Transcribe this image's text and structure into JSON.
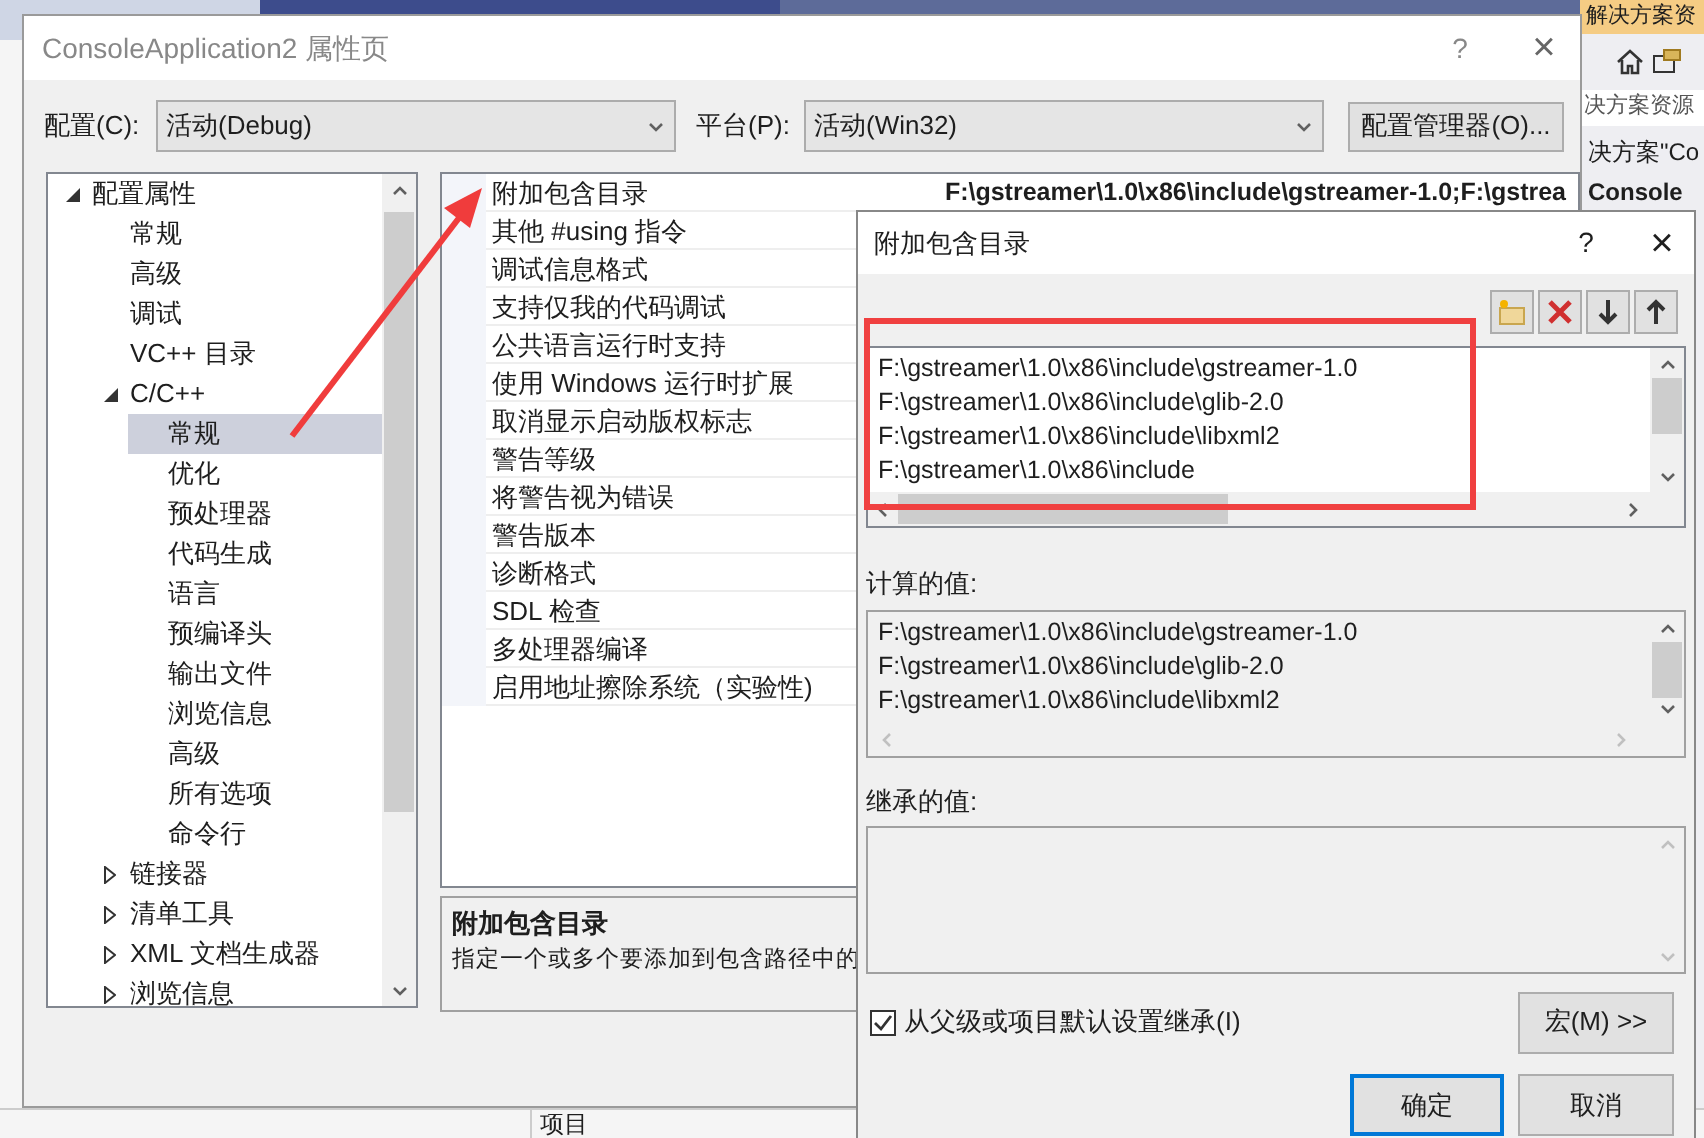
{
  "editor_tabs": [
    {
      "selected": false
    },
    {
      "selected": true
    }
  ],
  "solution_explorer": {
    "title": "解决方案资",
    "search": "决方案资源",
    "lines": [
      "决方案\"Co",
      "Console"
    ]
  },
  "bottom_bar": {
    "column_1": "项目"
  },
  "dialog": {
    "title": "ConsoleApplication2 属性页",
    "help": "?",
    "close": "×",
    "config_label": "配置(C):",
    "config_value": "活动(Debug)",
    "platform_label": "平台(P):",
    "platform_value": "活动(Win32)",
    "manager_button": "配置管理器(O)...",
    "tree": [
      {
        "label": "配置属性",
        "selected": false,
        "expanded": true,
        "children": [
          {
            "label": "常规",
            "selected": false
          },
          {
            "label": "高级",
            "selected": false
          },
          {
            "label": "调试",
            "selected": false
          },
          {
            "label": "VC++ 目录",
            "selected": false
          },
          {
            "label": "C/C++",
            "selected": false,
            "expanded": true,
            "children": [
              {
                "label": "常规",
                "selected": true
              },
              {
                "label": "优化",
                "selected": false
              },
              {
                "label": "预处理器",
                "selected": false
              },
              {
                "label": "代码生成",
                "selected": false
              },
              {
                "label": "语言",
                "selected": false
              },
              {
                "label": "预编译头",
                "selected": false
              },
              {
                "label": "输出文件",
                "selected": false
              },
              {
                "label": "浏览信息",
                "selected": false
              },
              {
                "label": "高级",
                "selected": false
              },
              {
                "label": "所有选项",
                "selected": false
              },
              {
                "label": "命令行",
                "selected": false
              }
            ]
          },
          {
            "label": "链接器",
            "selected": false,
            "expanded": false
          },
          {
            "label": "清单工具",
            "selected": false,
            "expanded": false
          },
          {
            "label": "XML 文档生成器",
            "selected": false,
            "expanded": false
          },
          {
            "label": "浏览信息",
            "selected": false,
            "expanded": false
          }
        ]
      }
    ],
    "properties": [
      {
        "name": "附加包含目录",
        "value": "F:\\gstreamer\\1.0\\x86\\include\\gstreamer-1.0;F:\\gstrea"
      },
      {
        "name": "其他 #using 指令"
      },
      {
        "name": "调试信息格式"
      },
      {
        "name": "支持仅我的代码调试"
      },
      {
        "name": "公共语言运行时支持"
      },
      {
        "name": "使用 Windows 运行时扩展"
      },
      {
        "name": "取消显示启动版权标志"
      },
      {
        "name": "警告等级"
      },
      {
        "name": "将警告视为错误"
      },
      {
        "name": "警告版本"
      },
      {
        "name": "诊断格式"
      },
      {
        "name": "SDL 检查"
      },
      {
        "name": "多处理器编译"
      },
      {
        "name": "启用地址擦除系统（实验性)"
      }
    ],
    "description": {
      "title": "附加包含目录",
      "text": "指定一个或多个要添加到包含路径中的"
    }
  },
  "sub_dialog": {
    "title": "附加包含目录",
    "help": "?",
    "close": "×",
    "entries": [
      "F:\\gstreamer\\1.0\\x86\\include\\gstreamer-1.0",
      "F:\\gstreamer\\1.0\\x86\\include\\glib-2.0",
      "F:\\gstreamer\\1.0\\x86\\include\\libxml2",
      "F:\\gstreamer\\1.0\\x86\\include"
    ],
    "computed_label": "计算的值:",
    "computed": [
      "F:\\gstreamer\\1.0\\x86\\include\\gstreamer-1.0",
      "F:\\gstreamer\\1.0\\x86\\include\\glib-2.0",
      "F:\\gstreamer\\1.0\\x86\\include\\libxml2"
    ],
    "inherited_label": "继承的值:",
    "inherit": {
      "label": "从父级或项目默认设置继承(I)",
      "checked": true
    },
    "macro_button": "宏(M) >>",
    "ok_button": "确定",
    "cancel_button": "取消"
  }
}
